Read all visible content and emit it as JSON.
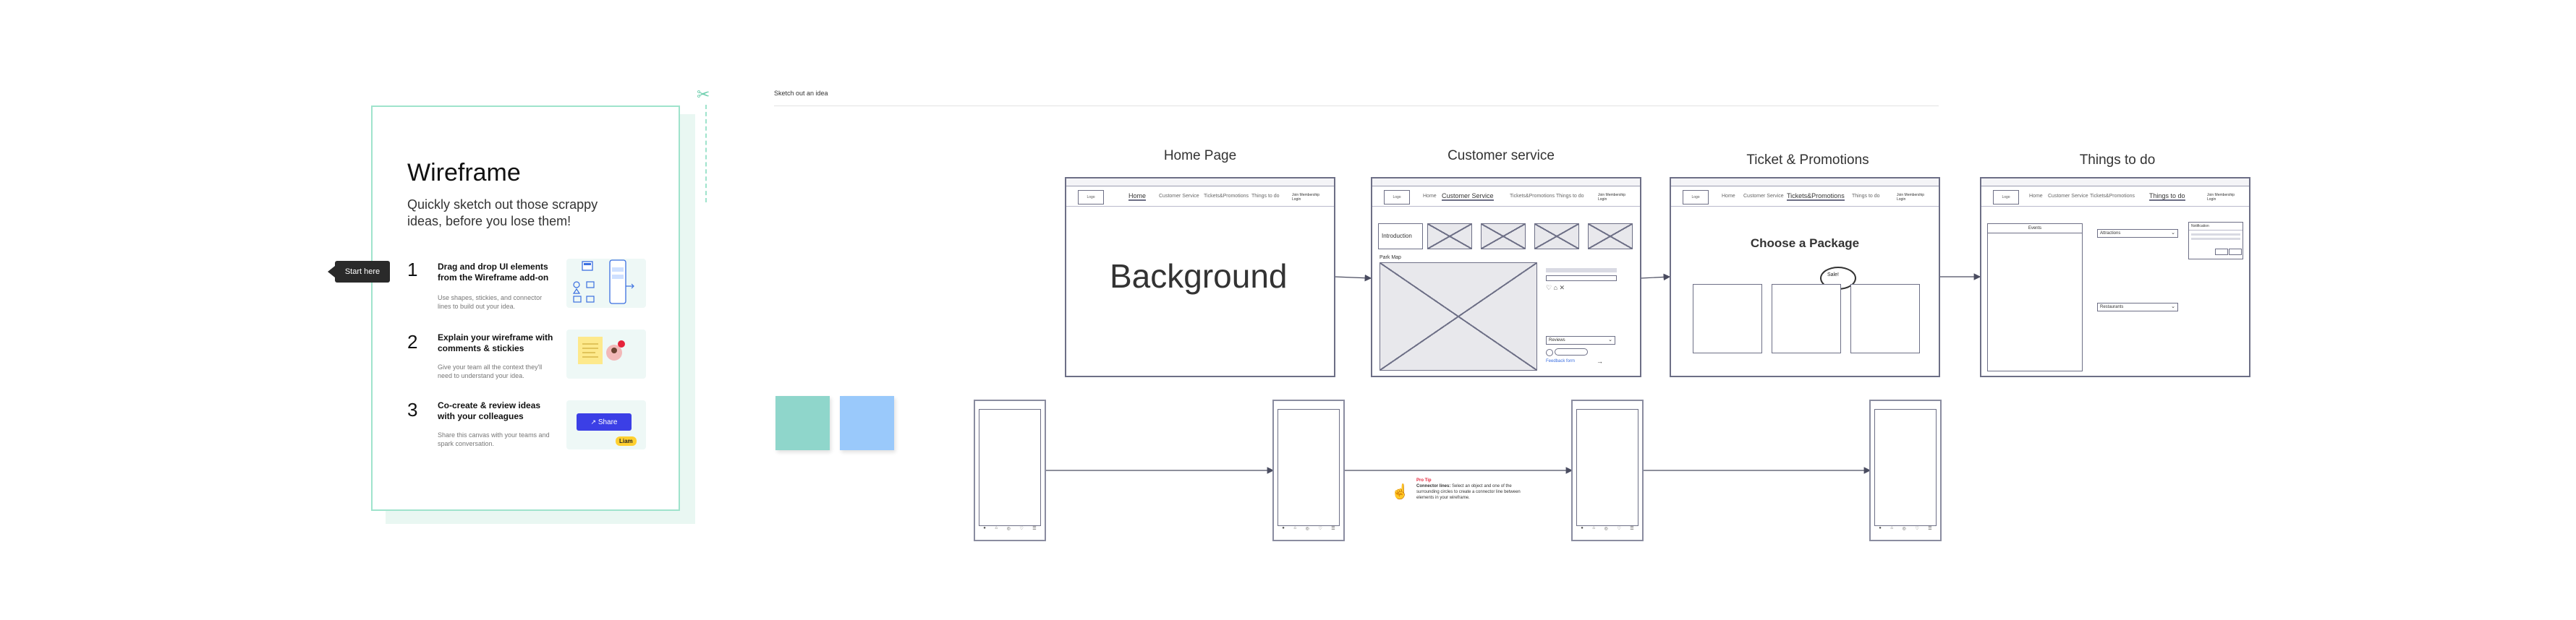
{
  "card": {
    "start_tag": "Start here",
    "title": "Wireframe",
    "subtitle": "Quickly sketch out those scrappy ideas, before you lose them!",
    "steps": [
      {
        "number": "1",
        "title": "Drag and drop UI elements from the Wireframe add-on",
        "desc": "Use shapes, stickies, and connector lines to build out your idea."
      },
      {
        "number": "2",
        "title": "Explain your wireframe with comments & stickies",
        "desc": "Give your team all the context they'll need to understand your idea."
      },
      {
        "number": "3",
        "title": "Co-create & review ideas with your colleagues",
        "desc": "Share this canvas with your teams and spark conversation."
      }
    ],
    "share_button": "Share",
    "cursor_name": "Liam"
  },
  "board": {
    "section_label": "Sketch out an idea",
    "frames": [
      {
        "title": "Home Page",
        "nav": [
          "Home",
          "Customer Service",
          "Tickets&Promotions",
          "Things to do"
        ],
        "active": "Home",
        "account": "Join Membership Login",
        "logo": "Logo",
        "headline": "Background"
      },
      {
        "title": "Customer service",
        "nav": [
          "Home",
          "Customer Service",
          "Tickets&Promotions",
          "Things to do"
        ],
        "active": "Customer Service",
        "account": "Join Membership Login",
        "logo": "Logo",
        "intro": "Introduction",
        "map_label": "Park Map",
        "select_label": "Reviews",
        "link_label": "Feedback form"
      },
      {
        "title": "Ticket & Promotions",
        "nav": [
          "Home",
          "Customer Service",
          "Tickets&Promotions",
          "Things to do"
        ],
        "active": "Tickets&Promotions",
        "account": "Join Membership Login",
        "logo": "Logo",
        "heading": "Choose a Package",
        "bubble": "Sale!"
      },
      {
        "title": "Things to do",
        "nav": [
          "Home",
          "Customer Service",
          "Tickets&Promotions",
          "Things to do"
        ],
        "active": "Things to do",
        "account": "Join Membership Login",
        "logo": "Logo",
        "sidebar_label": "Events",
        "dropdown_1": "Attractions",
        "dropdown_2": "Restaurants",
        "popup_label": "Notification"
      }
    ],
    "pro_tip": {
      "label": "Pro Tip",
      "title": "Connector lines:",
      "text": "Select an object and one of the surrounding circles to create a connector line between elements in your wireframe."
    }
  },
  "colors": {
    "wire": "#6d6f86",
    "card_border": "#9fe3cc",
    "sticky_teal": "#8fd6cb",
    "sticky_blue": "#9ac9fb",
    "share": "#3b3fe6",
    "cursor_tag": "#ffd02f",
    "pro_tip_red": "#e5243b"
  },
  "icons": [
    "scissors-icon",
    "share-icon",
    "hand-pointer-icon",
    "arrow-right-icon"
  ]
}
